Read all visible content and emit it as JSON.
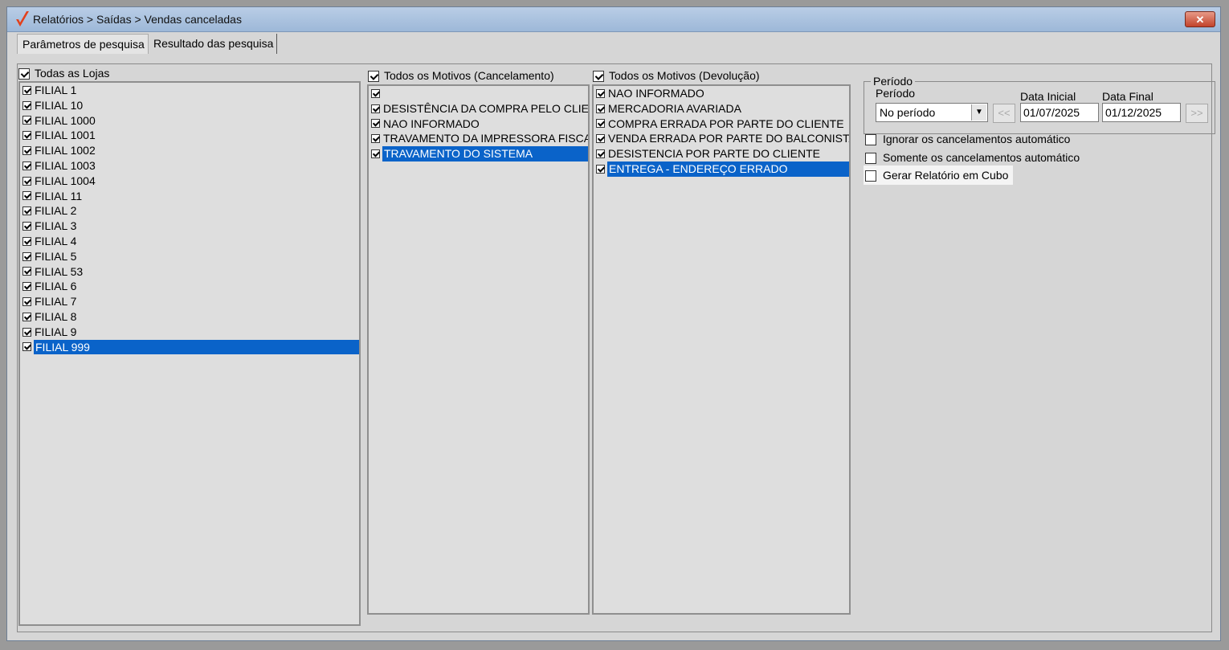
{
  "window": {
    "title": "Relatórios > Saídas > Vendas canceladas",
    "close_label": "✕"
  },
  "tabs": [
    {
      "label": "Parâmetros de pesquisa",
      "active": true
    },
    {
      "label": "Resultado das pesquisa",
      "active": false
    }
  ],
  "lojas": {
    "header": "Todas as Lojas",
    "checked": true,
    "items": [
      {
        "label": "FILIAL 1",
        "checked": true
      },
      {
        "label": "FILIAL 10",
        "checked": true
      },
      {
        "label": "FILIAL 1000",
        "checked": true
      },
      {
        "label": "FILIAL 1001",
        "checked": true
      },
      {
        "label": "FILIAL 1002",
        "checked": true
      },
      {
        "label": "FILIAL 1003",
        "checked": true
      },
      {
        "label": "FILIAL 1004",
        "checked": true
      },
      {
        "label": "FILIAL 11",
        "checked": true
      },
      {
        "label": "FILIAL 2",
        "checked": true
      },
      {
        "label": "FILIAL 3",
        "checked": true
      },
      {
        "label": "FILIAL 4",
        "checked": true
      },
      {
        "label": "FILIAL 5",
        "checked": true
      },
      {
        "label": "FILIAL 53",
        "checked": true
      },
      {
        "label": "FILIAL 6",
        "checked": true
      },
      {
        "label": "FILIAL 7",
        "checked": true
      },
      {
        "label": "FILIAL 8",
        "checked": true
      },
      {
        "label": "FILIAL 9",
        "checked": true
      },
      {
        "label": "FILIAL 999",
        "checked": true,
        "selected": true
      }
    ]
  },
  "cancelamento": {
    "header": "Todos os Motivos (Cancelamento)",
    "checked": true,
    "items": [
      {
        "label": "",
        "checked": true
      },
      {
        "label": "DESISTÊNCIA DA COMPRA PELO CLIEN",
        "checked": true
      },
      {
        "label": "NAO INFORMADO",
        "checked": true
      },
      {
        "label": "TRAVAMENTO DA IMPRESSORA FISCAL",
        "checked": true
      },
      {
        "label": "TRAVAMENTO DO SISTEMA",
        "checked": true,
        "selected": true
      }
    ]
  },
  "devolucao": {
    "header": "Todos os Motivos (Devolução)",
    "checked": true,
    "items": [
      {
        "label": "NAO INFORMADO",
        "checked": true
      },
      {
        "label": "MERCADORIA AVARIADA",
        "checked": true
      },
      {
        "label": "COMPRA ERRADA POR PARTE DO CLIENTE",
        "checked": true
      },
      {
        "label": "VENDA ERRADA POR PARTE DO BALCONISTA",
        "checked": true
      },
      {
        "label": "DESISTENCIA POR PARTE DO CLIENTE",
        "checked": true
      },
      {
        "label": "ENTREGA - ENDEREÇO ERRADO",
        "checked": true,
        "selected": true
      }
    ]
  },
  "periodo": {
    "group_title": "Período",
    "select_label": "Período",
    "select_value": "No período",
    "data_inicial_label": "Data Inicial",
    "data_inicial": "01/07/2025",
    "data_final_label": "Data Final",
    "data_final": "01/12/2025",
    "prev_label": "<<",
    "next_label": ">>"
  },
  "options": [
    {
      "label": "Ignorar os cancelamentos automático",
      "checked": false
    },
    {
      "label": "Somente os cancelamentos automático",
      "checked": false
    },
    {
      "label": "Gerar Relatório em Cubo",
      "checked": false,
      "highlighted": true
    }
  ],
  "colors": {
    "selection": "#0a63c9",
    "titlebar": "#b9cde6",
    "close": "#c2432b",
    "logo": "#e2401c"
  }
}
